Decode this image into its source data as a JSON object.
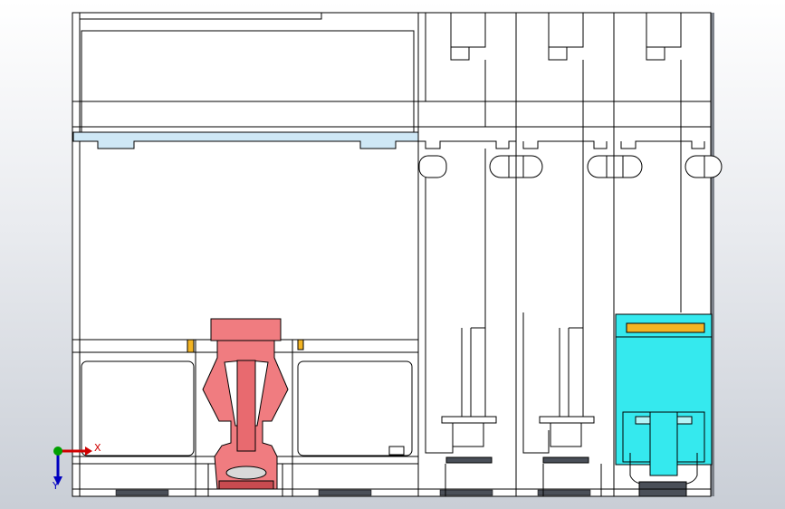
{
  "app": {
    "window_title": ""
  },
  "colors": {
    "background_top": "#ffffff",
    "background_bottom": "#c9ced6",
    "part_fill": "#ffffff",
    "edge": "#000000",
    "shadow_side": "#7a7f88",
    "light_blue_strip": "#cfe8f6",
    "red_component": "#f07c80",
    "red_dark": "#c84b50",
    "cyan_component": "#35e9ee",
    "orange_detail": "#f3b423",
    "dark_pad": "#4a4f58",
    "axis_x": "#d00000",
    "axis_y": "#00a000",
    "axis_z": "#0000c0"
  },
  "triad": {
    "x_label": "X",
    "y_label": "Y",
    "icon": "coordinate-triad-icon"
  }
}
